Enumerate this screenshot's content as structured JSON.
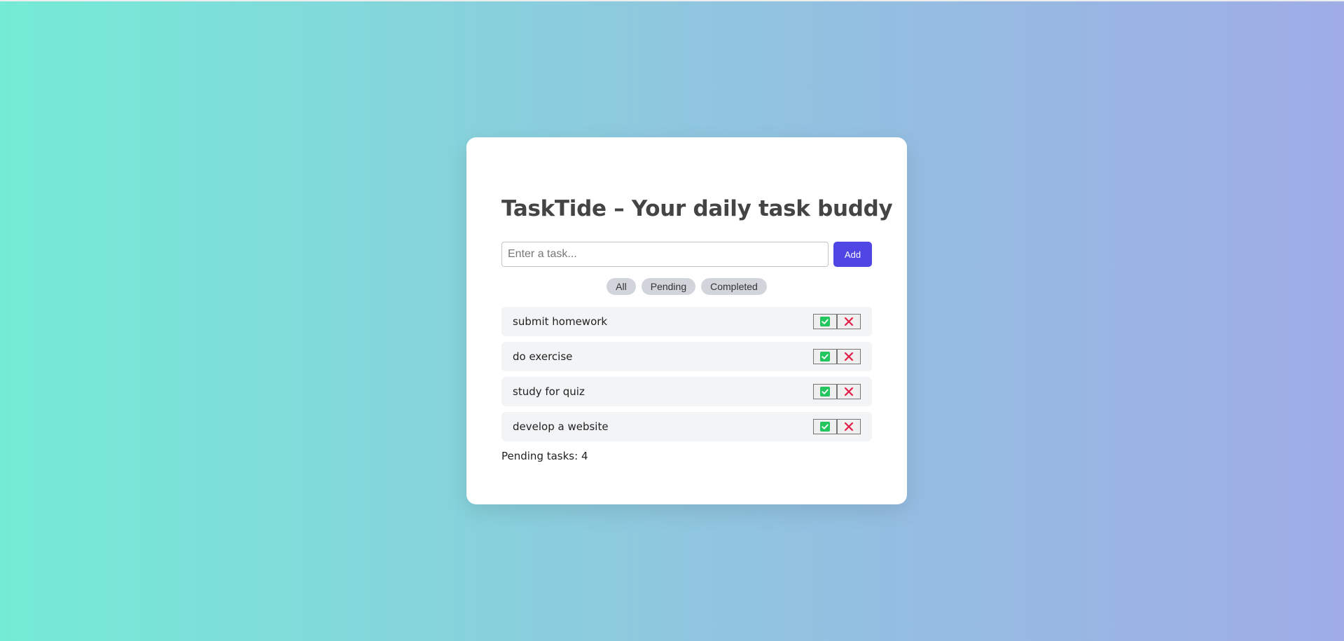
{
  "app": {
    "title": "TaskTide – Your daily task buddy"
  },
  "input": {
    "placeholder": "Enter a task...",
    "value": ""
  },
  "add_button": {
    "label": "Add"
  },
  "filters": [
    {
      "label": "All"
    },
    {
      "label": "Pending"
    },
    {
      "label": "Completed"
    }
  ],
  "tasks": [
    {
      "text": "submit homework",
      "complete_icon": "check-square-icon",
      "delete_icon": "x-icon"
    },
    {
      "text": "do exercise",
      "complete_icon": "check-square-icon",
      "delete_icon": "x-icon"
    },
    {
      "text": "study for quiz",
      "complete_icon": "check-square-icon",
      "delete_icon": "x-icon"
    },
    {
      "text": "develop a website",
      "complete_icon": "check-square-icon",
      "delete_icon": "x-icon"
    }
  ],
  "footer": {
    "pending_text": "Pending tasks: 4"
  },
  "colors": {
    "accent": "#4f46e5",
    "check": "#22c55e",
    "delete": "#e11d48",
    "gradient_start": "#74ebd5",
    "gradient_end": "#9face6"
  }
}
